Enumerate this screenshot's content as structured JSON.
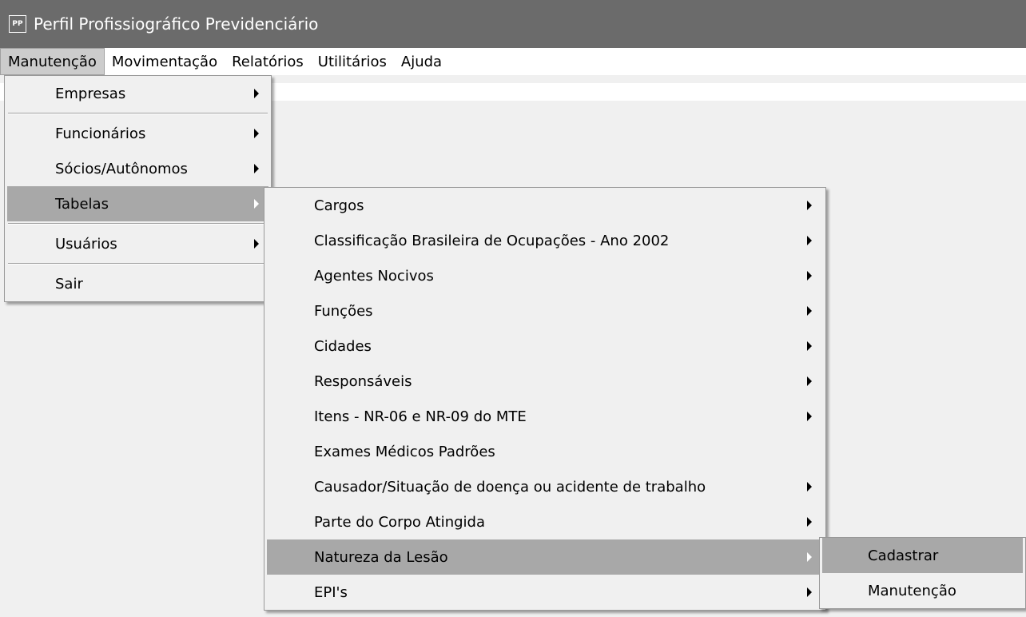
{
  "window": {
    "title": "Perfil Profissiográfico Previdenciário",
    "icon": "PP"
  },
  "menubar": {
    "items": [
      {
        "label": "Manutenção"
      },
      {
        "label": "Movimentação"
      },
      {
        "label": "Relatórios"
      },
      {
        "label": "Utilitários"
      },
      {
        "label": "Ajuda"
      }
    ]
  },
  "menu_manutencao": {
    "items": [
      {
        "label": "Empresas",
        "submenu": true
      },
      {
        "label": "Funcionários",
        "submenu": true
      },
      {
        "label": "Sócios/Autônomos",
        "submenu": true
      },
      {
        "label": "Tabelas",
        "submenu": true,
        "highlighted": true
      },
      {
        "label": "Usuários",
        "submenu": true
      },
      {
        "label": "Sair",
        "submenu": false
      }
    ]
  },
  "menu_tabelas": {
    "items": [
      {
        "label": "Cargos",
        "submenu": true
      },
      {
        "label": "Classificação Brasileira de Ocupações - Ano 2002",
        "submenu": true
      },
      {
        "label": "Agentes Nocivos",
        "submenu": true
      },
      {
        "label": "Funções",
        "submenu": true
      },
      {
        "label": "Cidades",
        "submenu": true
      },
      {
        "label": "Responsáveis",
        "submenu": true
      },
      {
        "label": "Itens - NR-06 e NR-09 do MTE",
        "submenu": true
      },
      {
        "label": "Exames Médicos Padrões",
        "submenu": false
      },
      {
        "label": "Causador/Situação de doença ou acidente de trabalho",
        "submenu": true
      },
      {
        "label": "Parte do Corpo Atingida",
        "submenu": true
      },
      {
        "label": "Natureza da Lesão",
        "submenu": true,
        "highlighted": true
      },
      {
        "label": "EPI's",
        "submenu": true
      }
    ]
  },
  "menu_natureza": {
    "items": [
      {
        "label": "Cadastrar",
        "highlighted": true
      },
      {
        "label": "Manutenção"
      }
    ]
  },
  "colors": {
    "titlebar": "#6b6b6b",
    "highlight": "#a8a8a8",
    "menu_bg": "#f0f0f0"
  },
  "icons": {
    "submenu_arrow": "chevron-right-icon"
  }
}
